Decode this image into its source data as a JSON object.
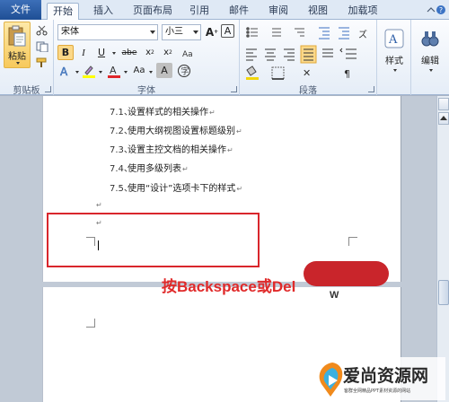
{
  "tabs": [
    {
      "label": "文件"
    },
    {
      "label": "开始"
    },
    {
      "label": "插入"
    },
    {
      "label": "页面布局"
    },
    {
      "label": "引用"
    },
    {
      "label": "邮件"
    },
    {
      "label": "审阅"
    },
    {
      "label": "视图"
    },
    {
      "label": "加载项"
    }
  ],
  "ribbon": {
    "clipboard": {
      "paste_label": "粘贴",
      "group_label": "剪贴板"
    },
    "font": {
      "font_name": "宋体",
      "font_size": "小三",
      "group_label": "字体"
    },
    "paragraph": {
      "group_label": "段落"
    },
    "styles": {
      "label": "样式"
    },
    "editing": {
      "label": "编辑"
    }
  },
  "document": {
    "page1_lines": [
      {
        "num": "7.1、",
        "text": "设置样式的相关操作"
      },
      {
        "num": "7.2、",
        "text": "使用大纲视图设置标题级别"
      },
      {
        "num": "7.3、",
        "text": "设置主控文档的相关操作"
      },
      {
        "num": "7.4、",
        "text": "使用多级列表"
      },
      {
        "num": "7.5、",
        "text": "使用“设计”选项卡下的样式"
      }
    ],
    "paragraph_mark": "↵"
  },
  "overlay": {
    "instruction": "按Backspace或Del",
    "small_logo": "W"
  },
  "watermark": {
    "title": "爱尚资源网",
    "subtitle": "客群全网精品PPT素材资源的网站"
  },
  "colors": {
    "file_tab": "#2b579a",
    "highlight_red": "#d9262c",
    "ribbon_bg": "#e5edf7"
  }
}
